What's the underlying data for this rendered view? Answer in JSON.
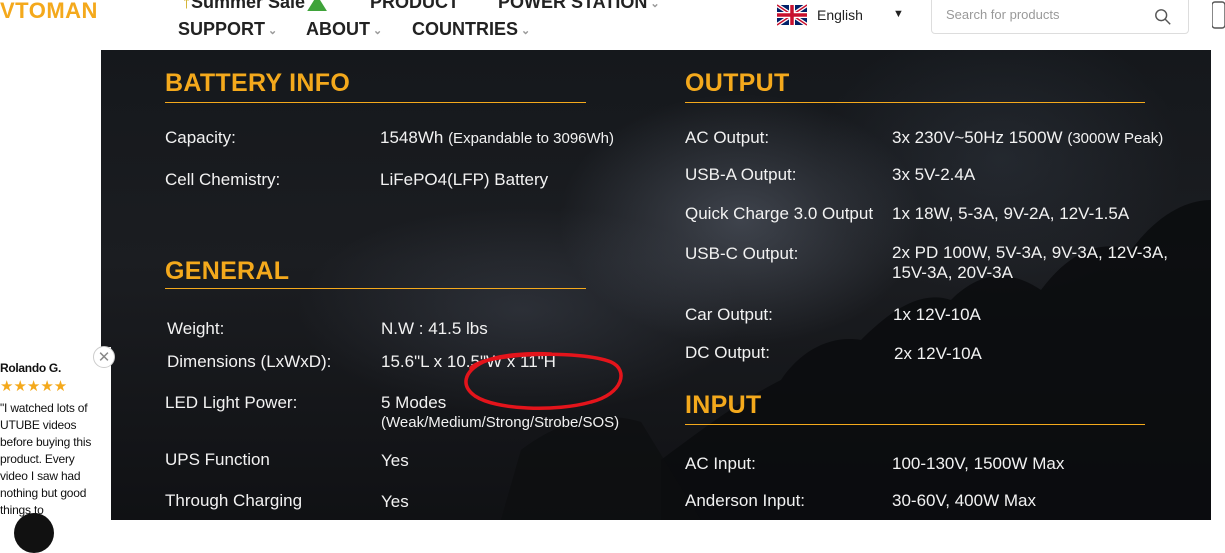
{
  "header": {
    "logo": "VTOMAN",
    "nav_top": [
      "Summer Sale",
      "PRODUCT",
      "POWER STATION"
    ],
    "nav_bottom": [
      "SUPPORT",
      "ABOUT",
      "COUNTRIES"
    ],
    "language": "English",
    "search_placeholder": "Search for products"
  },
  "battery": {
    "title": "BATTERY INFO",
    "rows": [
      {
        "label": "Capacity:",
        "value": "1548Wh",
        "note": "(Expandable to 3096Wh)"
      },
      {
        "label": "Cell Chemistry:",
        "value": "LiFePO4(LFP) Battery"
      }
    ]
  },
  "general": {
    "title": "GENERAL",
    "rows": [
      {
        "label": "Weight:",
        "value": "N.W : 41.5 lbs"
      },
      {
        "label": "Dimensions (LxWxD):",
        "value": "15.6\"L x 10.5\"W x 11\"H"
      },
      {
        "label": "LED Light Power:",
        "value": "5 Modes",
        "note": "(Weak/Medium/Strong/Strobe/SOS)"
      },
      {
        "label": "UPS Function",
        "value": "Yes"
      },
      {
        "label": "Through Charging",
        "value": "Yes"
      }
    ]
  },
  "output": {
    "title": "OUTPUT",
    "rows": [
      {
        "label": "AC Output:",
        "value": "3x 230V~50Hz 1500W",
        "note": "(3000W Peak)"
      },
      {
        "label": "USB-A Output:",
        "value": "3x 5V-2.4A"
      },
      {
        "label": "Quick Charge 3.0 Output",
        "value": "1x 18W, 5-3A, 9V-2A, 12V-1.5A"
      },
      {
        "label": "USB-C Output:",
        "value": "2x PD 100W, 5V-3A, 9V-3A, 12V-3A,",
        "value2": "15V-3A, 20V-3A"
      },
      {
        "label": "Car Output:",
        "value": "1x 12V-10A"
      },
      {
        "label": "DC Output:",
        "value": "2x 12V-10A"
      }
    ]
  },
  "input": {
    "title": "INPUT",
    "rows": [
      {
        "label": "AC Input:",
        "value": "100-130V, 1500W Max"
      },
      {
        "label": "Anderson Input:",
        "value": "30-60V, 400W Max"
      }
    ]
  },
  "review": {
    "name": "Rolando G.",
    "stars": "★★★★★",
    "text": "\"I watched lots of UTUBE videos before buying this product. Every video I saw had nothing but good things to"
  },
  "colors": {
    "accent": "#f4a91c",
    "panel": "#1a1c20",
    "annotation": "#e4141b"
  },
  "icons": {
    "search": "search-icon",
    "flag": "uk-flag-icon",
    "close": "close-icon"
  }
}
